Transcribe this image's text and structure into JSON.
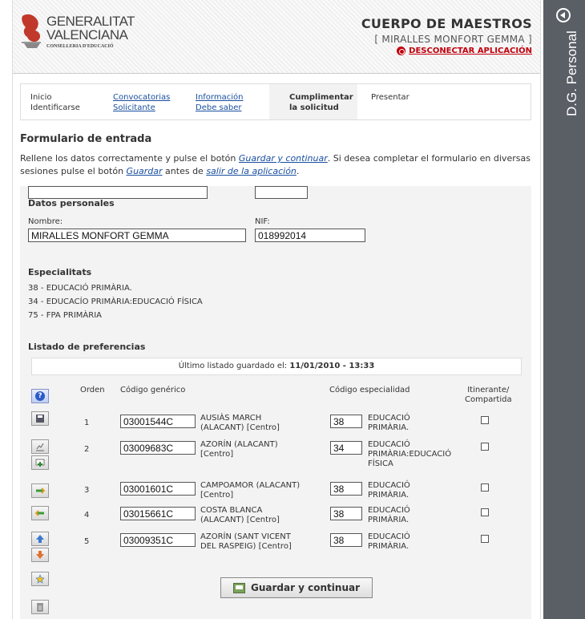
{
  "sidebar": {
    "label": "D.G. Personal"
  },
  "header": {
    "logo_line1": "GENERALITAT",
    "logo_line2": "VALENCIANA",
    "logo_sub": "CONSELLERIA D'EDUCACIÓ",
    "title": "CUERPO DE MAESTROS",
    "user": "[ MIRALLES MONFORT GEMMA ]",
    "logout": "DESCONECTAR APLICACIÓN"
  },
  "steps": [
    {
      "line1": "Inicio",
      "line2": "Identificarse"
    },
    {
      "line1": "Convocatorias",
      "line2": "Solicitante"
    },
    {
      "line1": "Información",
      "line2": "Debe saber"
    },
    {
      "line1": "Cumplimentar",
      "line2": "la solicitud"
    },
    {
      "line1": "Presentar",
      "line2": ""
    }
  ],
  "form": {
    "title": "Formulario de entrada",
    "intro_1": "Rellene los datos correctamente y pulse el botón ",
    "intro_link1": "Guardar y continuar",
    "intro_2": ". Si desea completar el formulario en diversas sesiones pulse el botón ",
    "intro_link2": "Guardar",
    "intro_3": " antes de ",
    "intro_link3": "salir de la aplicación",
    "intro_4": "."
  },
  "personal": {
    "section": "Datos personales",
    "nombre_label": "Nombre:",
    "nombre_value": "MIRALLES MONFORT GEMMA",
    "nif_label": "NIF:",
    "nif_value": "018992014"
  },
  "especialitats": {
    "section": "Especialitats",
    "items": [
      "38 - EDUCACIÓ PRIMÀRIA.",
      "34 - EDUCACÍO PRIMÀRIA:EDUCACIÓ FÍSICA",
      "75 - FPA PRIMÀRIA"
    ]
  },
  "preferencias": {
    "section": "Listado de preferencias",
    "saved_text": "Último listado guardado el: ",
    "saved_date": "11/01/2010 - 13:33",
    "col_orden": "Orden",
    "col_codigo": "Código genérico",
    "col_especialidad": "Código especialidad",
    "col_itinerante1": "Itinerante/",
    "col_itinerante2": "Compartida",
    "rows": [
      {
        "orden": "1",
        "codigo": "03001544C",
        "centro1": "AUSIÀS MARCH",
        "centro2": "(ALACANT) [Centro]",
        "esp": "38",
        "esp1": "EDUCACIÓ",
        "esp2": "PRIMÀRIA.",
        "esp3": ""
      },
      {
        "orden": "2",
        "codigo": "03009683C",
        "centro1": "AZORÍN (ALACANT)",
        "centro2": "[Centro]",
        "esp": "34",
        "esp1": "EDUCACIÓ",
        "esp2": "PRIMÀRIA:EDUCACIÓ",
        "esp3": "FÍSICA"
      },
      {
        "orden": "3",
        "codigo": "03001601C",
        "centro1": "CAMPOAMOR (ALACANT)",
        "centro2": "[Centro]",
        "esp": "38",
        "esp1": "EDUCACIÓ",
        "esp2": "PRIMÀRIA.",
        "esp3": ""
      },
      {
        "orden": "4",
        "codigo": "03015661C",
        "centro1": "COSTA BLANCA",
        "centro2": "(ALACANT) [Centro]",
        "esp": "38",
        "esp1": "EDUCACIÓ",
        "esp2": "PRIMÀRIA.",
        "esp3": ""
      },
      {
        "orden": "5",
        "codigo": "03009351C",
        "centro1": "AZORÍN (SANT VICENT",
        "centro2": "DEL RASPEIG) [Centro]",
        "esp": "38",
        "esp1": "EDUCACIÓ",
        "esp2": "PRIMÀRIA.",
        "esp3": ""
      }
    ],
    "save_button": "Guardar y continuar"
  },
  "icons": [
    "help-icon",
    "save-icon",
    "stats-icon",
    "add-row-icon",
    "move-icon",
    "move-icon",
    "up-arrow-icon",
    "down-arrow-icon",
    "star-icon",
    "delete-icon"
  ]
}
